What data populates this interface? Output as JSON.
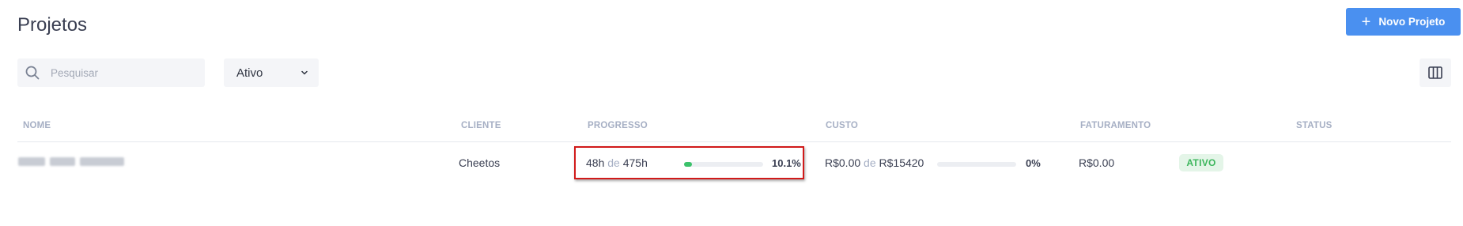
{
  "page": {
    "title": "Projetos"
  },
  "toolbar": {
    "new_button_label": "Novo Projeto",
    "search_placeholder": "Pesquisar",
    "status_filter_value": "Ativo",
    "accent_color": "#4a90f0"
  },
  "table": {
    "headers": [
      "NOME",
      "CLIENTE",
      "PROGRESSO",
      "CUSTO",
      "FATURAMENTO",
      "STATUS"
    ],
    "rows": [
      {
        "client": "Cheetos",
        "progress_used": "48h",
        "progress_sep": "de",
        "progress_total": "475h",
        "progress_percent": "10.1%",
        "progress_fraction": 0.101,
        "cost_used": "R$0.00",
        "cost_sep": "de",
        "cost_total": "R$15420",
        "cost_percent": "0%",
        "cost_fraction": 0,
        "billing": "R$0.00",
        "status": "ATIVO",
        "status_color": "#3cb65c"
      }
    ]
  },
  "icons": [
    "plus-icon",
    "search-icon",
    "chevron-down-icon",
    "columns-icon"
  ]
}
